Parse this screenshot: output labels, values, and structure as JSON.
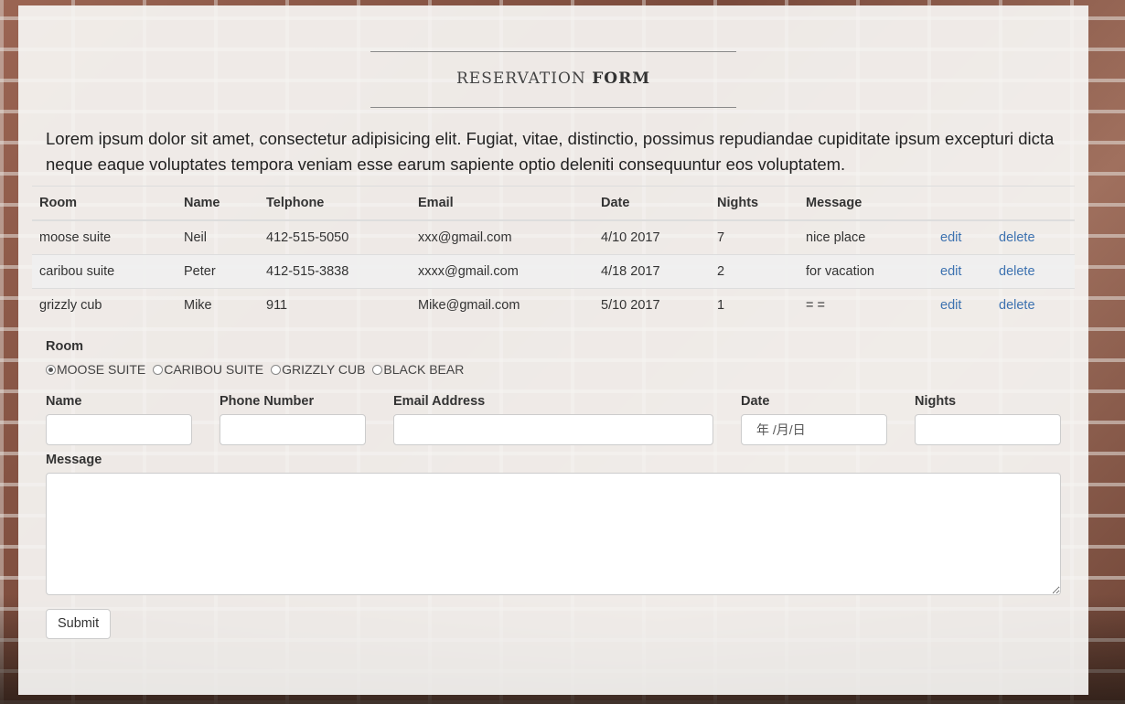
{
  "header": {
    "title_light": "RESERVATION",
    "title_bold": "FORM"
  },
  "intro": "Lorem ipsum dolor sit amet, consectetur adipisicing elit. Fugiat, vitae, distinctio, possimus repudiandae cupiditate ipsum excepturi dicta neque eaque voluptates tempora veniam esse earum sapiente optio deleniti consequuntur eos voluptatem.",
  "table": {
    "headers": [
      "Room",
      "Name",
      "Telphone",
      "Email",
      "Date",
      "Nights",
      "Message"
    ],
    "rows": [
      {
        "room": "moose suite",
        "name": "Neil",
        "phone": "412-515-5050",
        "email": "xxx@gmail.com",
        "date": "4/10 2017",
        "nights": "7",
        "message": "nice place",
        "edit": "edit",
        "delete": "delete"
      },
      {
        "room": "caribou suite",
        "name": "Peter",
        "phone": "412-515-3838",
        "email": "xxxx@gmail.com",
        "date": "4/18 2017",
        "nights": "2",
        "message": "for vacation",
        "edit": "edit",
        "delete": "delete"
      },
      {
        "room": "grizzly cub",
        "name": "Mike",
        "phone": "911",
        "email": "Mike@gmail.com",
        "date": "5/10 2017",
        "nights": "1",
        "message": "= =",
        "edit": "edit",
        "delete": "delete"
      }
    ]
  },
  "form": {
    "room_label": "Room",
    "room_options": [
      "MOOSE SUITE",
      "CARIBOU SUITE",
      "GRIZZLY CUB",
      "BLACK BEAR"
    ],
    "room_selected": "MOOSE SUITE",
    "name_label": "Name",
    "name_value": "",
    "phone_label": "Phone Number",
    "phone_value": "",
    "email_label": "Email Address",
    "email_value": "",
    "date_label": "Date",
    "date_placeholder": "年 /月/日",
    "nights_label": "Nights",
    "nights_value": "",
    "message_label": "Message",
    "message_value": "",
    "submit_label": "Submit"
  },
  "colors": {
    "link": "#3d72b0",
    "panel": "#f6f5f3"
  }
}
